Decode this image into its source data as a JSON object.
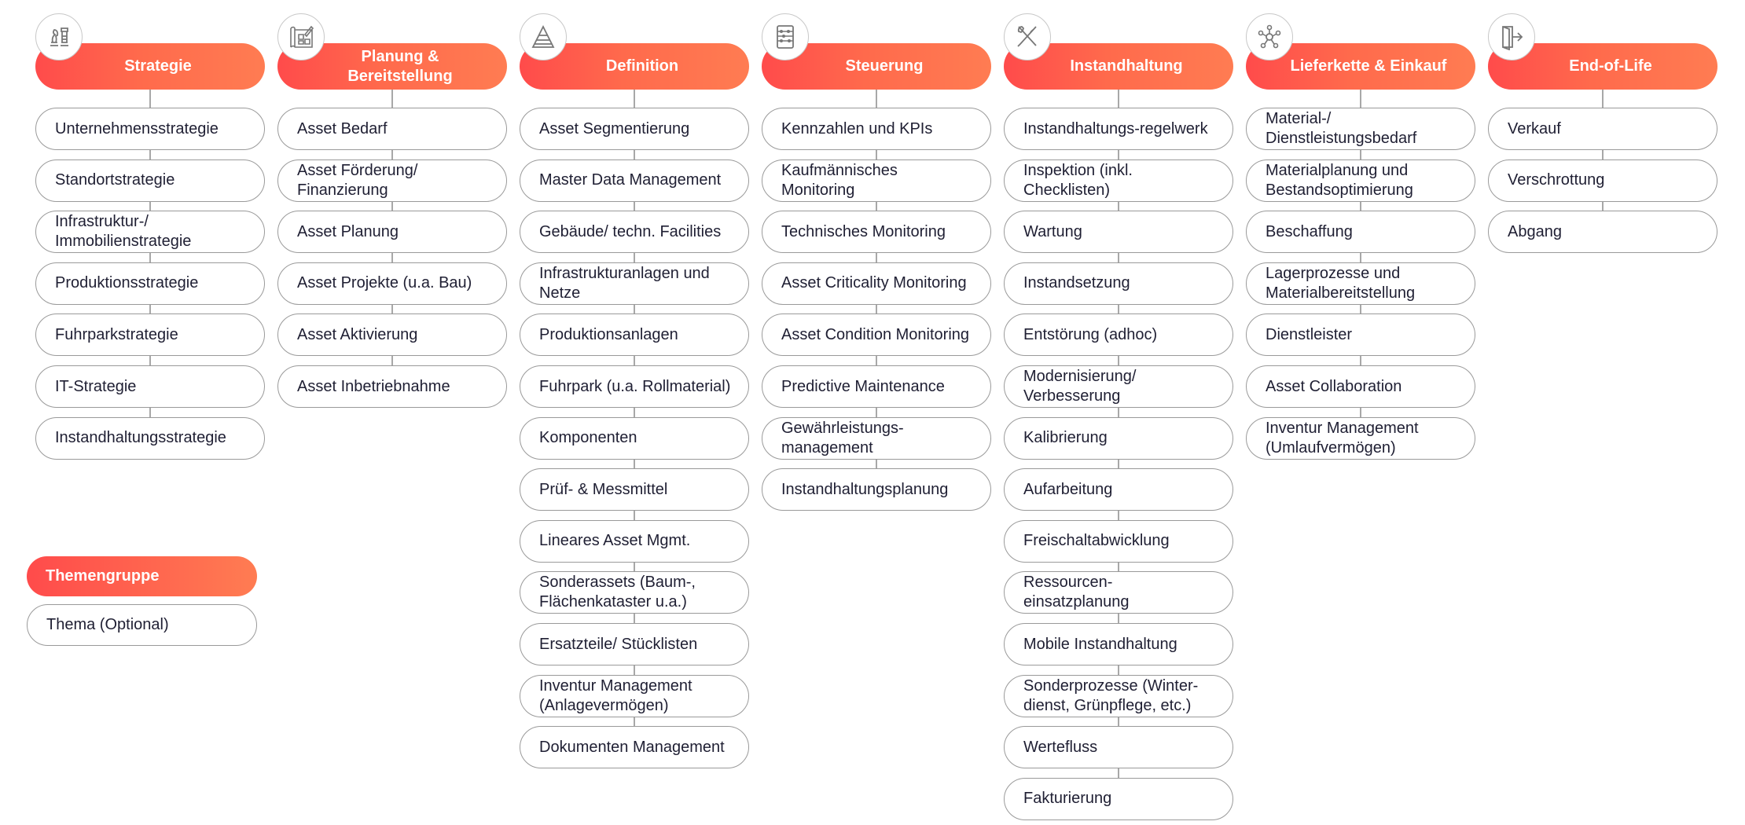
{
  "colors": {
    "header_gradient_start": "#ff4b4b",
    "header_gradient_end": "#ff7c52",
    "item_border": "#9a9a9a",
    "connector": "#a8a8a8"
  },
  "columns": [
    {
      "title": "Strategie",
      "icon": "chess-pieces-icon",
      "items": [
        "Unternehmensstrategie",
        "Standortstrategie",
        "Infrastruktur-/ Immobilienstrategie",
        "Produktionsstrategie",
        "Fuhrparkstrategie",
        "IT-Strategie",
        "Instandhaltungsstrategie"
      ]
    },
    {
      "title": "Planung & Bereitstellung",
      "icon": "blueprint-icon",
      "items": [
        "Asset Bedarf",
        "Asset Förderung/ Finanzierung",
        "Asset Planung",
        "Asset Projekte (u.a. Bau)",
        "Asset Aktivierung",
        "Asset Inbetriebnahme"
      ]
    },
    {
      "title": "Definition",
      "icon": "pyramid-icon",
      "items": [
        "Asset Segmentierung",
        "Master Data Management",
        "Gebäude/ techn. Facilities",
        "Infrastrukturanlagen und Netze",
        "Produktionsanlagen",
        "Fuhrpark (u.a. Rollmaterial)",
        "Komponenten",
        "Prüf- & Messmittel",
        "Lineares Asset Mgmt.",
        "Sonderassets (Baum-, Flächenkataster u.a.)",
        "Ersatzteile/ Stücklisten",
        "Inventur Management (Anlagevermögen)",
        "Dokumenten Management"
      ]
    },
    {
      "title": "Steuerung",
      "icon": "abacus-icon",
      "items": [
        "Kennzahlen und KPIs",
        "Kaufmännisches Monitoring",
        "Technisches Monitoring",
        "Asset Criticality Monitoring",
        "Asset Condition Monitoring",
        "Predictive Maintenance",
        "Gewährleistungs-management",
        "Instandhaltungsplanung"
      ]
    },
    {
      "title": "Instandhaltung",
      "icon": "wrench-screwdriver-icon",
      "items": [
        "Instandhaltungs-regelwerk",
        "Inspektion (inkl. Checklisten)",
        "Wartung",
        "Instandsetzung",
        "Entstörung (adhoc)",
        "Modernisierung/ Verbesserung",
        "Kalibrierung",
        "Aufarbeitung",
        "Freischaltabwicklung",
        "Ressourcen-einsatzplanung",
        "Mobile Instandhaltung",
        "Sonderprozesse (Winter-dienst, Grünpflege, etc.)",
        "Wertefluss",
        "Fakturierung"
      ]
    },
    {
      "title": "Lieferkette & Einkauf",
      "icon": "network-hub-icon",
      "items": [
        "Material-/ Dienstleistungsbedarf",
        "Materialplanung und Bestandsoptimierung",
        "Beschaffung",
        "Lagerprozesse und Materialbereitstellung",
        "Dienstleister",
        "Asset Collaboration",
        "Inventur Management (Umlaufvermögen)"
      ]
    },
    {
      "title": "End-of-Life",
      "icon": "exit-door-icon",
      "items": [
        "Verkauf",
        "Verschrottung",
        "Abgang"
      ]
    }
  ],
  "legend": {
    "group_label": "Themengruppe",
    "topic_label": "Thema (Optional)"
  }
}
